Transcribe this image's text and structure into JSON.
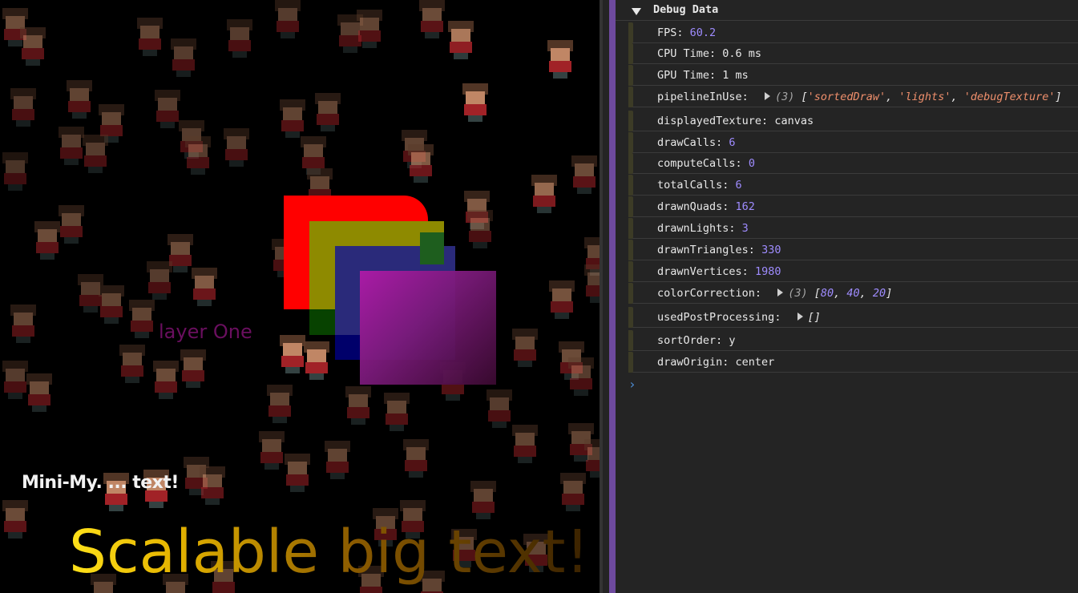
{
  "game": {
    "mini_text": "Mini-My. ... text!",
    "player_label": "layer One",
    "big_text": "Scalable big text!"
  },
  "console": {
    "group_title": "Debug Data",
    "entries": [
      {
        "key": "FPS",
        "value": "60.2",
        "value_type": "number"
      },
      {
        "key": "CPU Time",
        "value": "0.6 ms",
        "value_type": "plain"
      },
      {
        "key": "GPU Time",
        "value": "1 ms",
        "value_type": "plain"
      },
      {
        "key": "pipelineInUse",
        "preview_count": "(3)",
        "items": [
          "'sortedDraw'",
          "'lights'",
          "'debugTexture'"
        ],
        "value_type": "string-array"
      },
      {
        "key": "displayedTexture",
        "value": "canvas",
        "value_type": "plain"
      },
      {
        "key": "drawCalls",
        "value": "6",
        "value_type": "number"
      },
      {
        "key": "computeCalls",
        "value": "0",
        "value_type": "number"
      },
      {
        "key": "totalCalls",
        "value": "6",
        "value_type": "number"
      },
      {
        "key": "drawnQuads",
        "value": "162",
        "value_type": "number"
      },
      {
        "key": "drawnLights",
        "value": "3",
        "value_type": "number"
      },
      {
        "key": "drawnTriangles",
        "value": "330",
        "value_type": "number"
      },
      {
        "key": "drawnVertices",
        "value": "1980",
        "value_type": "number"
      },
      {
        "key": "colorCorrection",
        "preview_count": "(3)",
        "items": [
          "80",
          "40",
          "20"
        ],
        "value_type": "number-array"
      },
      {
        "key": "usedPostProcessing",
        "preview_count": "",
        "items": [],
        "value_type": "empty-array"
      },
      {
        "key": "sortOrder",
        "value": "y",
        "value_type": "plain"
      },
      {
        "key": "drawOrigin",
        "value": "center",
        "value_type": "plain"
      }
    ],
    "prompt_glyph": "›"
  },
  "colors": {
    "number": "#9f8cff",
    "string": "#ef8f6c",
    "splitter": "#6e4a9e",
    "prompt": "#4e8fd8"
  }
}
